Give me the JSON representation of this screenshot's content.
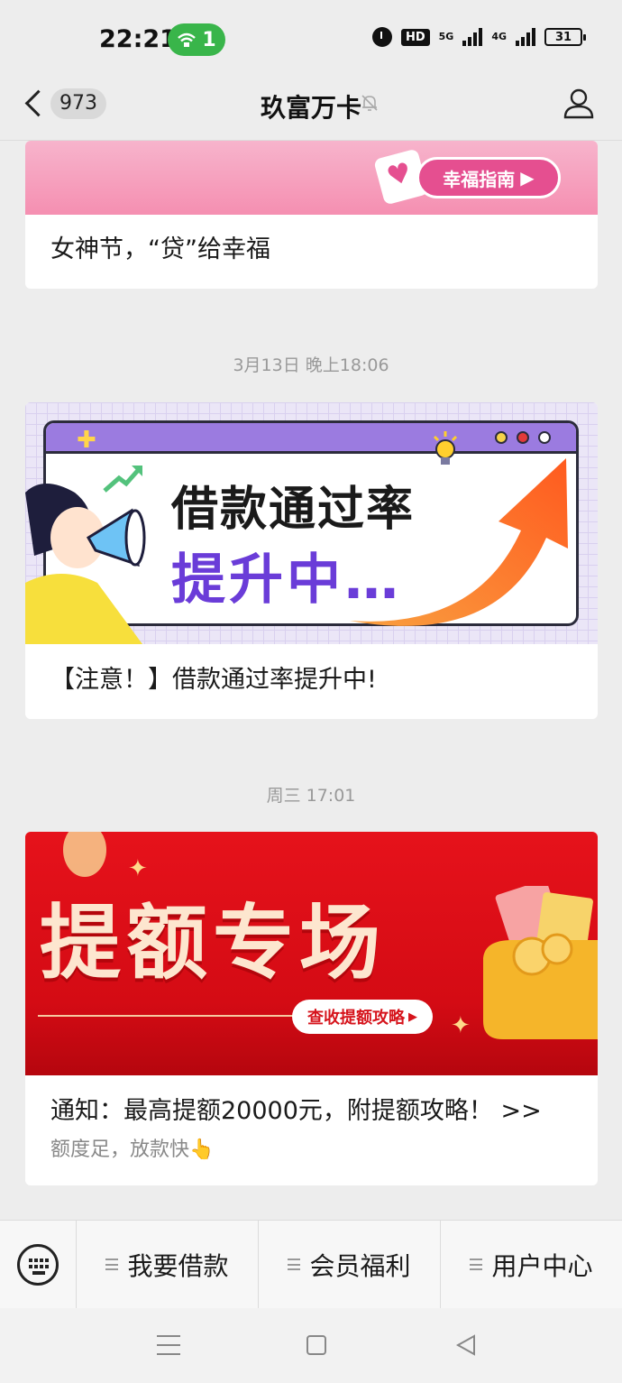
{
  "status": {
    "time": "22:21",
    "hotspot_count": "1",
    "hd": "HD",
    "net1": "5G",
    "net2": "4G",
    "battery": "31"
  },
  "header": {
    "unread_count": "973",
    "title": "玖富万卡"
  },
  "messages": [
    {
      "banner_button": "幸福指南",
      "caption": "女神节，“贷”给幸福"
    },
    {
      "timestamp": "3月13日 晚上18:06",
      "banner_line1": "借款通过率",
      "banner_line2": "提升中…",
      "caption": "【注意！】借款通过率提升中!"
    },
    {
      "timestamp": "周三 17:01",
      "banner_title": "提额专场",
      "banner_button": "查收提额攻略",
      "caption": "通知：最高提额20000元，附提额攻略！ >>",
      "subtext": "额度足，放款快👆"
    }
  ],
  "menu": {
    "items": [
      "我要借款",
      "会员福利",
      "用户中心"
    ]
  }
}
